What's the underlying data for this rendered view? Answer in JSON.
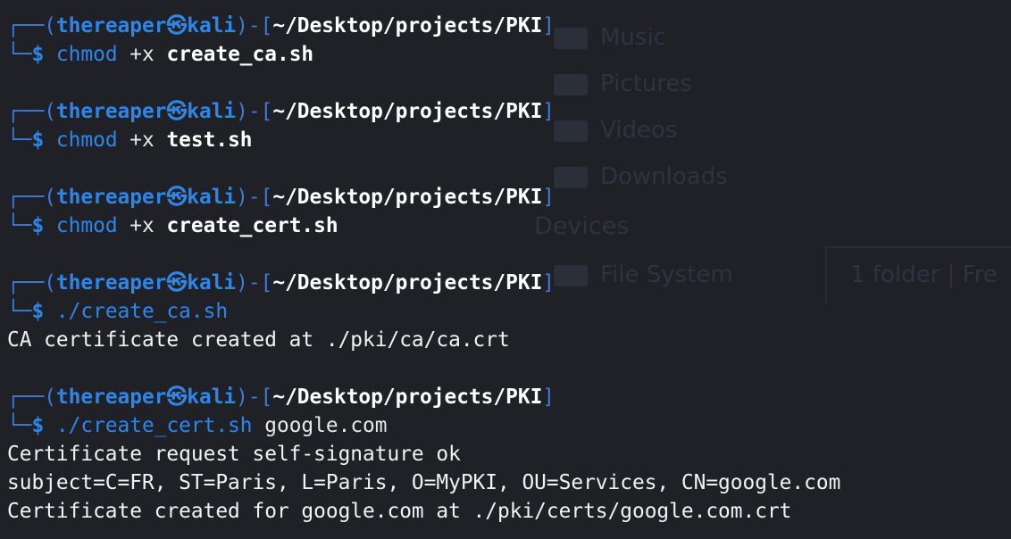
{
  "background_ghost": {
    "items": [
      "Music",
      "Pictures",
      "Videos",
      "Downloads"
    ],
    "devices_heading": "Devices",
    "file_system": "File System",
    "status": "1 folder  |  Fre"
  },
  "prompt": {
    "corner_top": "┌──",
    "corner_bottom": "└─",
    "open": "(",
    "user": "thereaper",
    "at": "㉿",
    "host": "kali",
    "close": ")-[",
    "path": "~/Desktop/projects/PKI",
    "close_bracket": "]",
    "dollar": "$"
  },
  "blocks": [
    {
      "command": "chmod",
      "args": " +x ",
      "file": "create_ca.sh",
      "output": []
    },
    {
      "command": "chmod",
      "args": " +x ",
      "file": "test.sh",
      "output": []
    },
    {
      "command": "chmod",
      "args": " +x ",
      "file": "create_cert.sh",
      "output": []
    },
    {
      "command": "./create_ca.sh",
      "args": "",
      "file": "",
      "output": [
        "CA certificate created at ./pki/ca/ca.crt"
      ]
    },
    {
      "command": "./create_cert.sh",
      "args": " google.com",
      "file": "",
      "output": [
        "Certificate request self-signature ok",
        "subject=C=FR, ST=Paris, L=Paris, O=MyPKI, OU=Services, CN=google.com",
        "Certificate created for google.com at ./pki/certs/google.com.crt"
      ]
    }
  ]
}
